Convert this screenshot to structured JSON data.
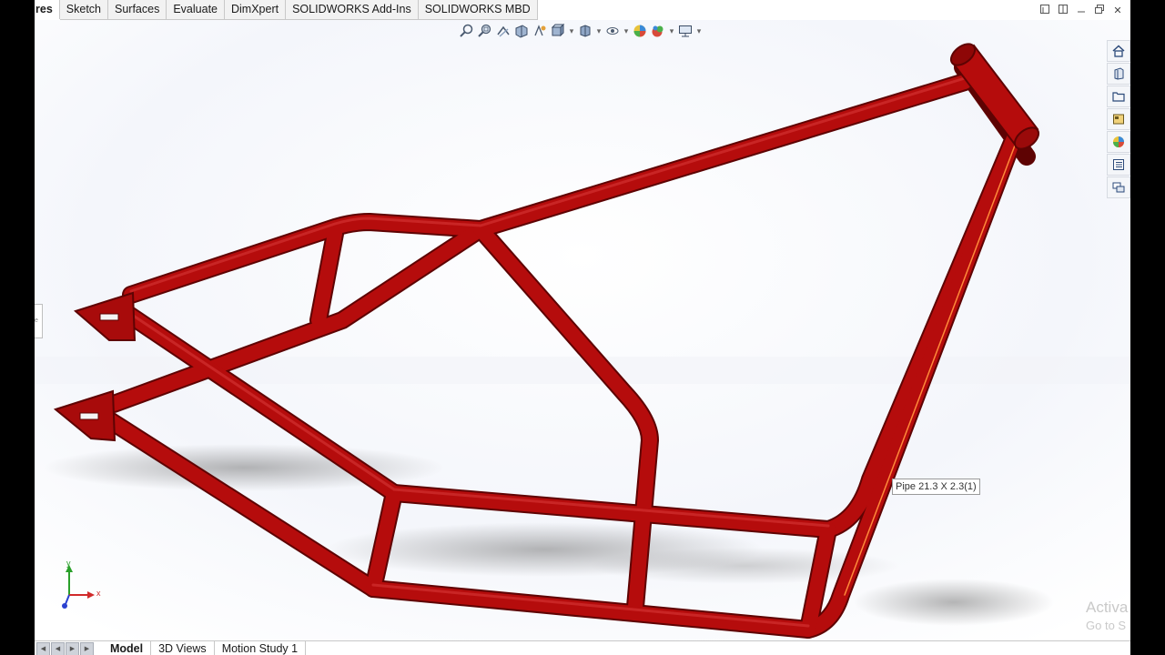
{
  "command_manager": {
    "tabs": [
      {
        "label": "res",
        "active": true
      },
      {
        "label": "Sketch",
        "active": false
      },
      {
        "label": "Surfaces",
        "active": false
      },
      {
        "label": "Evaluate",
        "active": false
      },
      {
        "label": "DimXpert",
        "active": false
      },
      {
        "label": "SOLIDWORKS Add-Ins",
        "active": false
      },
      {
        "label": "SOLIDWORKS MBD",
        "active": false
      }
    ]
  },
  "window_controls": {
    "icons": [
      "restore-icon",
      "tile-icon",
      "minimize-icon",
      "maximize-icon",
      "close-icon"
    ],
    "close_glyph": "✕"
  },
  "heads_up_toolbar": {
    "icons": [
      "zoom-to-fit-icon",
      "zoom-to-area-icon",
      "previous-view-icon",
      "section-view-icon",
      "dynamic-annotation-icon",
      "view-orientation-icon",
      "display-style-icon",
      "hide-show-items-icon",
      "edit-appearance-icon",
      "apply-scene-icon",
      "view-settings-icon"
    ]
  },
  "task_pane": {
    "icons": [
      "home-icon",
      "design-library-icon",
      "file-explorer-icon",
      "view-palette-icon",
      "appearances-icon",
      "custom-properties-icon",
      "forum-icon"
    ]
  },
  "viewport": {
    "model": "motorcycle frame weldment",
    "tube_color": "#b50c0c",
    "tooltip": "Pipe 21.3 X 2.3(1)"
  },
  "triad": {
    "x_label": "x",
    "y_label": "y"
  },
  "bottom_tabs": [
    {
      "label": "Model",
      "active": true
    },
    {
      "label": "3D Views",
      "active": false
    },
    {
      "label": "Motion Study 1",
      "active": false
    }
  ],
  "watermark": {
    "line1": "Activa",
    "line2": "Go to S"
  }
}
